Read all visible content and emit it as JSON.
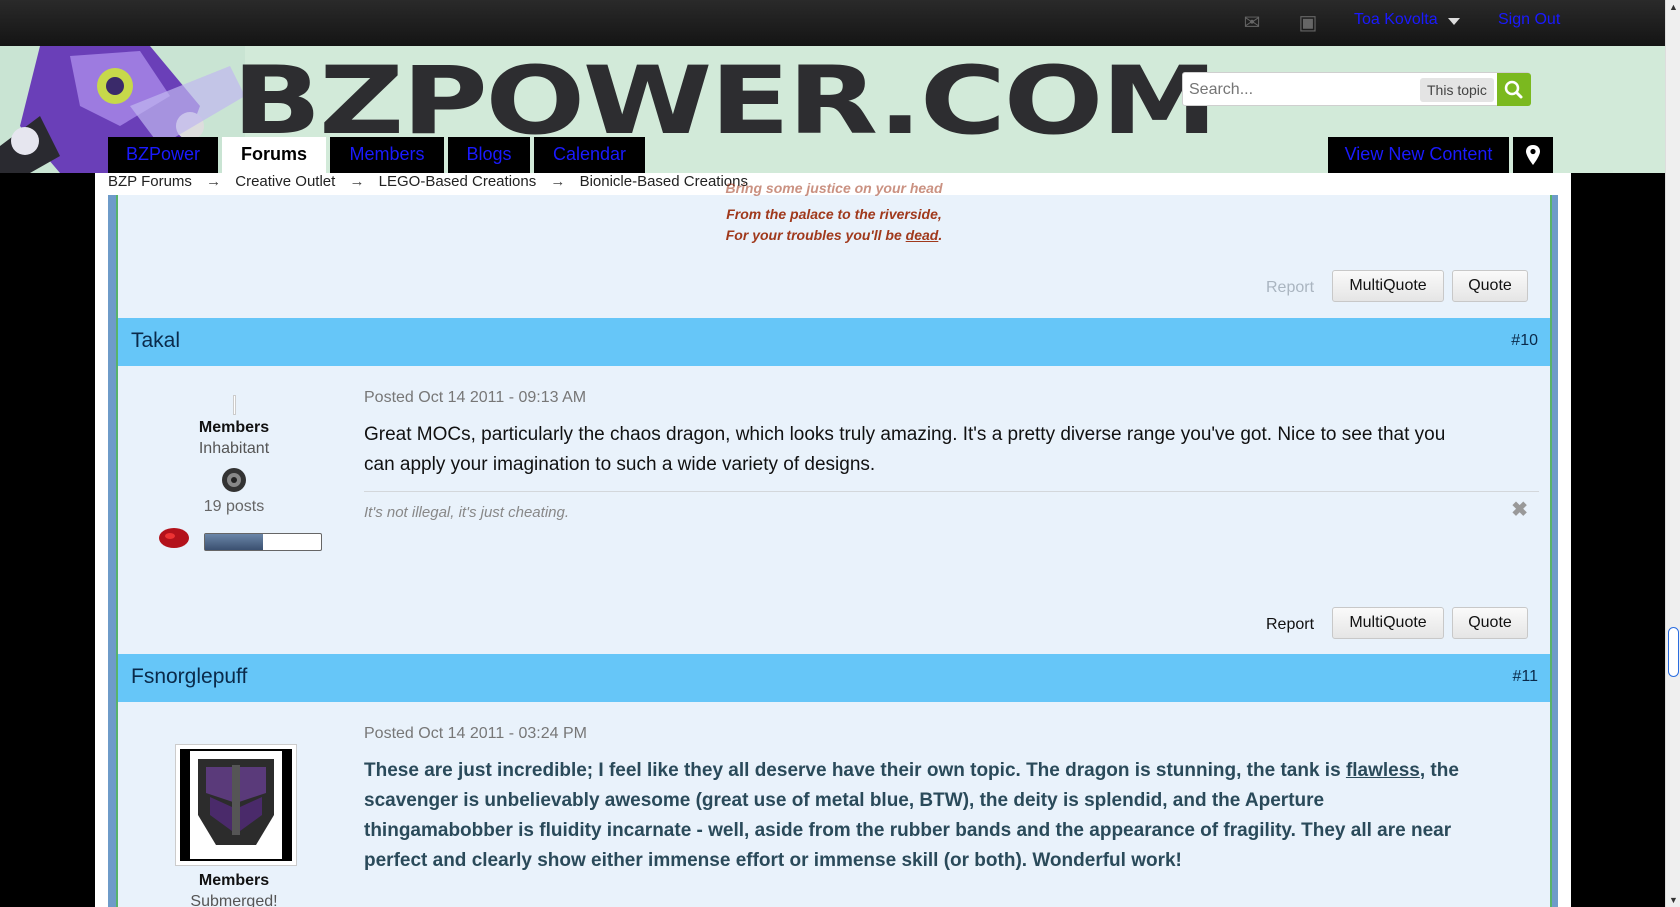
{
  "userbar": {
    "username": "Toa Kovolta",
    "signout_label": "Sign Out"
  },
  "branding": {
    "logo_text": "BZPOWER.COM"
  },
  "search": {
    "placeholder": "Search...",
    "scope_label": "This topic"
  },
  "nav": {
    "tabs": [
      {
        "label": "BZPower"
      },
      {
        "label": "Forums"
      },
      {
        "label": "Members"
      },
      {
        "label": "Blogs"
      },
      {
        "label": "Calendar"
      }
    ],
    "view_new_content_label": "View New Content"
  },
  "breadcrumb": {
    "arrow": "→",
    "items": [
      "BZP Forums",
      "Creative Outlet",
      "LEGO-Based Creations",
      "Bionicle-Based Creations"
    ]
  },
  "prev_post": {
    "signature_lines": [
      "Bring some justice on your head",
      "From the palace to the riverside,",
      "For your troubles you'll be"
    ],
    "signature_link": "dead",
    "signature_end": ".",
    "report_label": "Report",
    "multiquote_label": "MultiQuote",
    "quote_label": "Quote"
  },
  "post_10": {
    "author": "Takal",
    "number": "#10",
    "group": "Members",
    "rank": "Inhabitant",
    "post_count": "19 posts",
    "posted": "Posted Oct 14 2011 - 09:13 AM",
    "body": "Great MOCs, particularly the chaos dragon, which looks truly amazing. It's a pretty diverse range you've got. Nice to see that you can apply your imagination to such a wide variety of designs.",
    "signature": "It's not illegal, it's just cheating.",
    "report_label": "Report",
    "multiquote_label": "MultiQuote",
    "quote_label": "Quote",
    "close_glyph": "✖"
  },
  "post_11": {
    "author": "Fsnorglepuff",
    "number": "#11",
    "group": "Members",
    "rank": "Submerged!",
    "posted": "Posted Oct 14 2011 - 03:24 PM",
    "body_before": "These are just incredible; I feel like they all deserve have their own topic. The dragon is stunning, the tank is ",
    "body_link": "flawless",
    "body_after": ", the scavenger is unbelievably awesome (great use of metal blue, BTW), the deity is splendid, and the Aperture thingamabobber is fluidity incarnate - well, aside from the rubber bands and the appearance of fragility. They all are near perfect and clearly show either immense effort or immense skill (or both). Wonderful work!"
  },
  "colors": {
    "link_blue": "#1a1aff",
    "post_header": "#66c6f8",
    "post_bg": "#e9f2fb",
    "search_green": "#7bb91f",
    "signature_red": "#a0391c"
  }
}
